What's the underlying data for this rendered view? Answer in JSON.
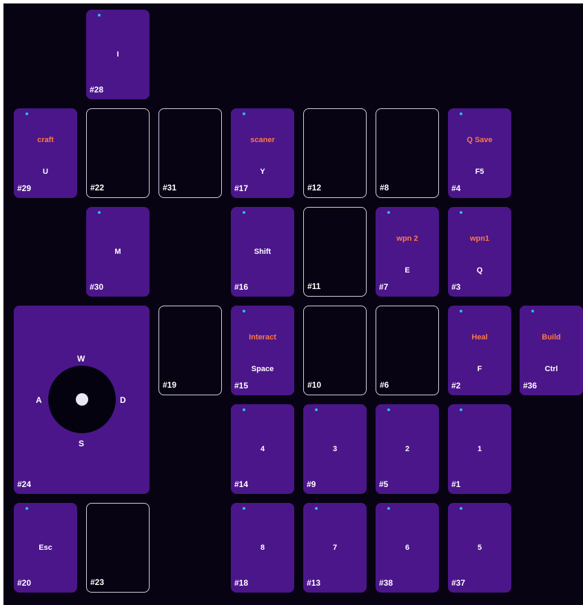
{
  "colors": {
    "background": "#070312",
    "key_fill": "#4b168a",
    "empty_border": "#d6d2e6",
    "action_text": "#ff7a45",
    "dot": "#1ec3ea"
  },
  "keys": [
    {
      "id": "k28",
      "number": "#28",
      "label": "I",
      "action": "",
      "dot": true,
      "empty": false
    },
    {
      "id": "k29",
      "number": "#29",
      "label": "U",
      "action": "craft",
      "dot": true,
      "empty": false
    },
    {
      "id": "k22",
      "number": "#22",
      "label": "",
      "action": "",
      "dot": false,
      "empty": true
    },
    {
      "id": "k31",
      "number": "#31",
      "label": "",
      "action": "",
      "dot": false,
      "empty": true
    },
    {
      "id": "k17",
      "number": "#17",
      "label": "Y",
      "action": "scaner",
      "dot": true,
      "empty": false
    },
    {
      "id": "k12",
      "number": "#12",
      "label": "",
      "action": "",
      "dot": false,
      "empty": true
    },
    {
      "id": "k8",
      "number": "#8",
      "label": "",
      "action": "",
      "dot": false,
      "empty": true
    },
    {
      "id": "k4",
      "number": "#4",
      "label": "F5",
      "action": "Q Save",
      "dot": true,
      "empty": false
    },
    {
      "id": "k30",
      "number": "#30",
      "label": "M",
      "action": "",
      "dot": true,
      "empty": false
    },
    {
      "id": "k16",
      "number": "#16",
      "label": "Shift",
      "action": "",
      "dot": true,
      "empty": false
    },
    {
      "id": "k11",
      "number": "#11",
      "label": "",
      "action": "",
      "dot": false,
      "empty": true
    },
    {
      "id": "k7",
      "number": "#7",
      "label": "E",
      "action": "wpn 2",
      "dot": true,
      "empty": false
    },
    {
      "id": "k3",
      "number": "#3",
      "label": "Q",
      "action": "wpn1",
      "dot": true,
      "empty": false
    },
    {
      "id": "k19",
      "number": "#19",
      "label": "",
      "action": "",
      "dot": false,
      "empty": true
    },
    {
      "id": "k15",
      "number": "#15",
      "label": "Space",
      "action": "Interact",
      "dot": true,
      "empty": false
    },
    {
      "id": "k10",
      "number": "#10",
      "label": "",
      "action": "",
      "dot": false,
      "empty": true
    },
    {
      "id": "k6",
      "number": "#6",
      "label": "",
      "action": "",
      "dot": false,
      "empty": true
    },
    {
      "id": "k2",
      "number": "#2",
      "label": "F",
      "action": "Heal",
      "dot": true,
      "empty": false
    },
    {
      "id": "k36",
      "number": "#36",
      "label": "Ctrl",
      "action": "Build",
      "dot": true,
      "empty": false
    },
    {
      "id": "k14",
      "number": "#14",
      "label": "4",
      "action": "",
      "dot": true,
      "empty": false
    },
    {
      "id": "k9",
      "number": "#9",
      "label": "3",
      "action": "",
      "dot": true,
      "empty": false
    },
    {
      "id": "k5",
      "number": "#5",
      "label": "2",
      "action": "",
      "dot": true,
      "empty": false
    },
    {
      "id": "k1",
      "number": "#1",
      "label": "1",
      "action": "",
      "dot": true,
      "empty": false
    },
    {
      "id": "k20",
      "number": "#20",
      "label": "Esc",
      "action": "",
      "dot": true,
      "empty": false
    },
    {
      "id": "k23",
      "number": "#23",
      "label": "",
      "action": "",
      "dot": false,
      "empty": true
    },
    {
      "id": "k18",
      "number": "#18",
      "label": "8",
      "action": "",
      "dot": true,
      "empty": false
    },
    {
      "id": "k13",
      "number": "#13",
      "label": "7",
      "action": "",
      "dot": true,
      "empty": false
    },
    {
      "id": "k38",
      "number": "#38",
      "label": "6",
      "action": "",
      "dot": true,
      "empty": false
    },
    {
      "id": "k37",
      "number": "#37",
      "label": "5",
      "action": "",
      "dot": true,
      "empty": false
    }
  ],
  "joystick": {
    "number": "#24",
    "up": "W",
    "left": "A",
    "right": "D",
    "down": "S"
  }
}
